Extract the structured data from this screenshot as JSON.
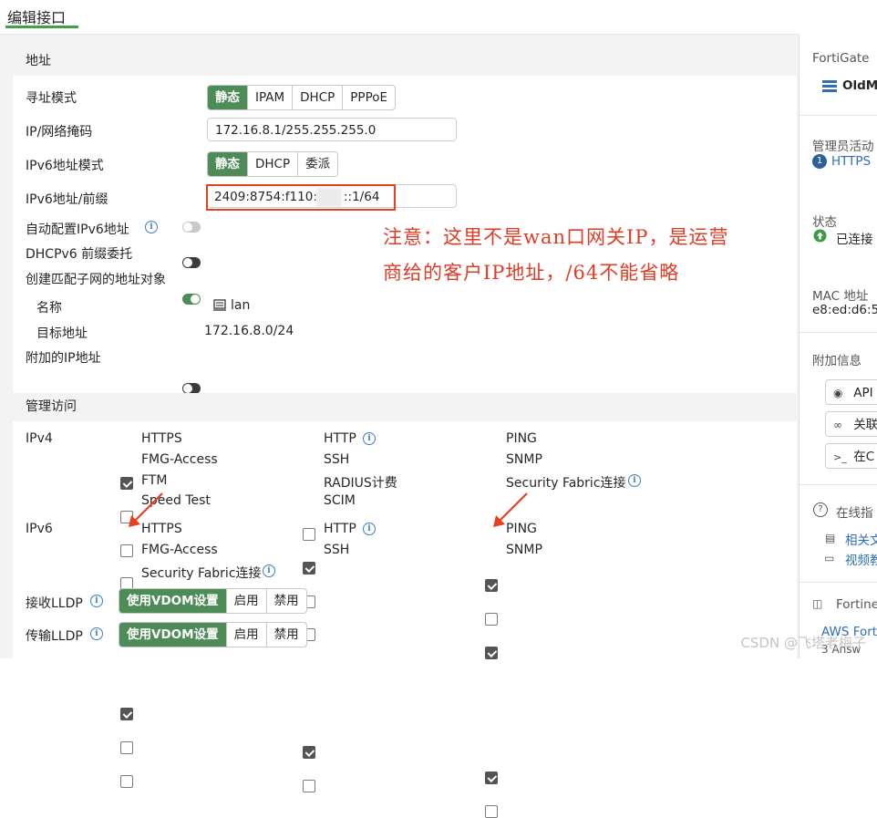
{
  "header": {
    "title": "编辑接口"
  },
  "address": {
    "section_title": "地址",
    "mode_label": "寻址模式",
    "mode_options": [
      "静态",
      "IPAM",
      "DHCP",
      "PPPoE"
    ],
    "ip_label": "IP/网络掩码",
    "ip_value": "172.16.8.1/255.255.255.0",
    "ipv6_mode_label": "IPv6地址模式",
    "ipv6_mode_options": [
      "静态",
      "DHCP",
      "委派"
    ],
    "ipv6_prefix_label": "IPv6地址/前缀",
    "ipv6_prefix_value_a": "2409:8754:f110:",
    "ipv6_prefix_value_b": "::1/64",
    "auto_ipv6_label": "自动配置IPv6地址",
    "dhcpv6_label": "DHCPv6 前缀委托",
    "create_subnet_label": "创建匹配子网的地址对象",
    "name_label": "名称",
    "name_value": "lan",
    "dest_label": "目标地址",
    "dest_value": "172.16.8.0/24",
    "extra_ip_label": "附加的IP地址"
  },
  "annotation": {
    "line1": "注意：这里不是wan口网关IP，是运营",
    "line2": "商给的客户IP地址，/64不能省略"
  },
  "admin": {
    "section_title": "管理访问",
    "ipv4_label": "IPv4",
    "ipv6_label": "IPv6",
    "ipv4_items": [
      {
        "label": "HTTPS",
        "checked": true
      },
      {
        "label": "HTTP",
        "checked": false
      },
      {
        "label": "PING",
        "checked": true
      },
      {
        "label": "FMG-Access",
        "checked": false
      },
      {
        "label": "SSH",
        "checked": true
      },
      {
        "label": "SNMP",
        "checked": false
      },
      {
        "label": "FTM",
        "checked": false
      },
      {
        "label": "RADIUS计费",
        "checked": false
      },
      {
        "label": "Security Fabric连接",
        "checked": true
      },
      {
        "label": "Speed Test",
        "checked": false
      },
      {
        "label": "SCIM",
        "checked": false
      }
    ],
    "ipv6_items": [
      {
        "label": "HTTPS",
        "checked": true
      },
      {
        "label": "HTTP",
        "checked": true
      },
      {
        "label": "PING",
        "checked": true
      },
      {
        "label": "FMG-Access",
        "checked": false
      },
      {
        "label": "SSH",
        "checked": false
      },
      {
        "label": "SNMP",
        "checked": false
      },
      {
        "label": "Security Fabric连接",
        "checked": false
      }
    ],
    "lldp_rx_label": "接收LLDP",
    "lldp_tx_label": "传输LLDP",
    "lldp_options": [
      "使用VDOM设置",
      "启用",
      "禁用"
    ]
  },
  "sidebar": {
    "fortigate_label": "FortiGate",
    "device_name": "OldM",
    "admin_activity_label": "管理员活动",
    "admin_count": "1",
    "admin_protocol": "HTTPS",
    "status_label": "状态",
    "status_value": "已连接",
    "mac_label": "MAC 地址",
    "mac_value": "e8:ed:d6:5",
    "extra_info_label": "附加信息",
    "btn_api": "API",
    "btn_link": "关联",
    "btn_cli": "在C",
    "online_help_label": "在线指",
    "link_related": "相关文",
    "link_video": "视频教",
    "fortinet_label": "Fortine",
    "aws_link": "AWS Fort",
    "answers": "3 Answ"
  },
  "watermark": "CSDN @飞塔老梅子",
  "colors": {
    "accent": "#4d8b57",
    "annotation": "#e03b24",
    "link": "#2e6fb5"
  }
}
